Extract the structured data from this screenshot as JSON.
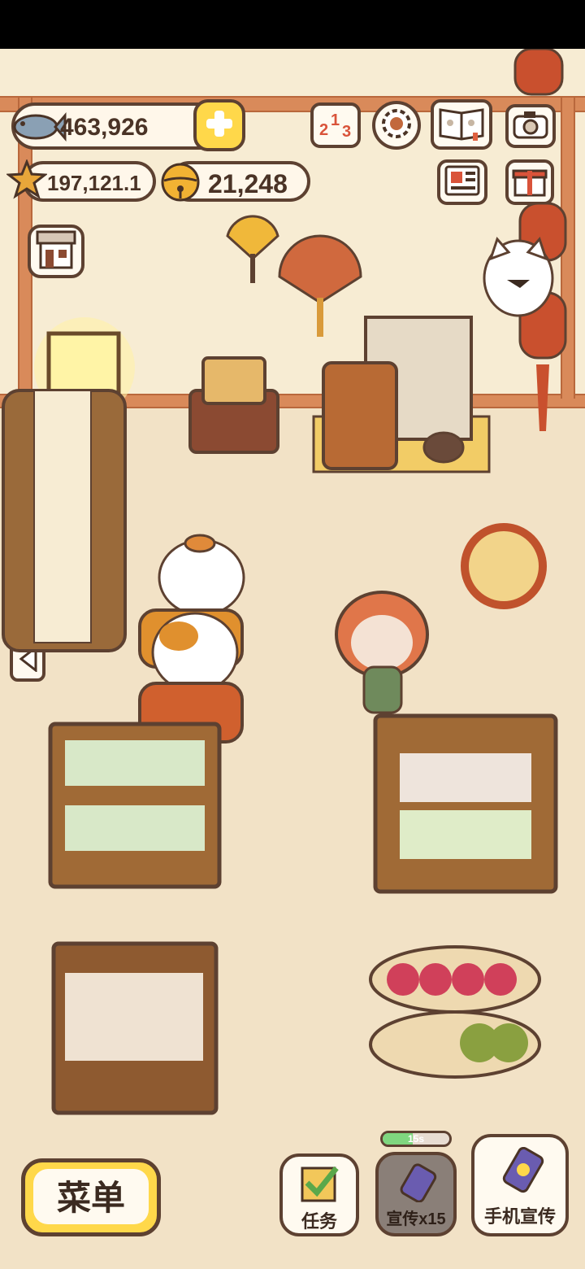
{
  "currency": {
    "fish": "463,926",
    "stars": "197,121.1",
    "bells": "21,248"
  },
  "icons": {
    "fish": "fish-icon",
    "add": "plus-icon",
    "star": "star-icon",
    "bell": "bell-icon",
    "ranking": "leaderboard-icon",
    "settings": "gear-icon",
    "book": "cat-book-icon",
    "camera": "camera-icon",
    "news": "newspaper-icon",
    "gift": "gift-icon",
    "shop": "shop-icon"
  },
  "buttons": {
    "menu": "菜单",
    "tasks": "任务",
    "promote": "宣传x15",
    "promote_timer": "15s",
    "phone_promote": "手机宣传"
  },
  "progress": {
    "promote_timer_fill": 0.45
  },
  "colors": {
    "accent_yellow": "#ffd84a",
    "outline": "#5d4131",
    "wood": "#d98a5a",
    "timer_green": "#7fd67f"
  }
}
